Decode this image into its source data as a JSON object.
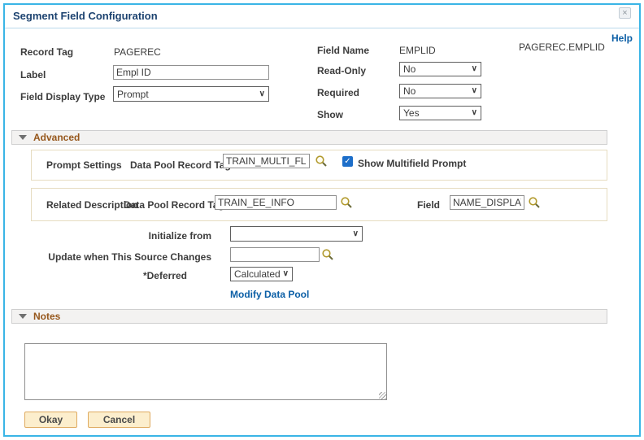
{
  "dialog": {
    "title": "Segment Field Configuration",
    "help_label": "Help"
  },
  "icons": {
    "close": "×",
    "chevron_down": "∨",
    "check": "✓"
  },
  "fields": {
    "record_tag": {
      "label": "Record Tag",
      "value": "PAGEREC"
    },
    "field_name": {
      "label": "Field Name",
      "value": "EMPLID"
    },
    "record_field_ref": "PAGEREC.EMPLID",
    "label_field": {
      "label": "Label",
      "value": "Empl ID"
    },
    "field_display_type": {
      "label": "Field Display Type",
      "value": "Prompt"
    },
    "read_only": {
      "label": "Read-Only",
      "value": "No"
    },
    "required": {
      "label": "Required",
      "value": "No"
    },
    "show": {
      "label": "Show",
      "value": "Yes"
    }
  },
  "advanced": {
    "header": "Advanced",
    "prompt_settings": {
      "label": "Prompt Settings",
      "record_tag_label": "Data Pool Record Tag",
      "record_tag_value": "TRAIN_MULTI_FLD",
      "checkbox_label": "Show Multifield Prompt",
      "checkbox_checked": true
    },
    "related_description": {
      "label": "Related Description",
      "record_tag_label": "Data Pool Record Tag",
      "record_tag_value": "TRAIN_EE_INFO",
      "field_label": "Field",
      "field_value": "NAME_DISPLAY"
    },
    "initialize_from": {
      "label": "Initialize from",
      "value": ""
    },
    "update_source": {
      "label": "Update when This Source Changes",
      "value": ""
    },
    "deferred": {
      "label": "*Deferred",
      "value": "Calculated"
    },
    "modify_link": "Modify Data Pool"
  },
  "notes": {
    "header": "Notes",
    "value": ""
  },
  "buttons": {
    "okay": "Okay",
    "cancel": "Cancel"
  }
}
